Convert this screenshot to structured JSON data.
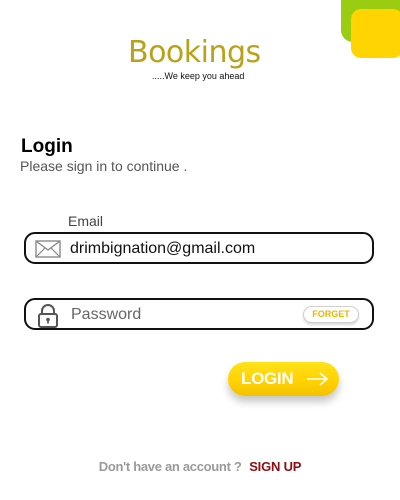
{
  "brand": {
    "title": "Bookings",
    "tagline": ".....We keep you ahead"
  },
  "login": {
    "heading": "Login",
    "subheading": "Please sign in to continue ."
  },
  "email": {
    "label": "Email",
    "value": "drimbignation@gmail.com",
    "icon": "envelope-icon"
  },
  "password": {
    "placeholder": "Password",
    "icon": "padlock-icon",
    "forget_label": "FORGET"
  },
  "submit": {
    "label": "LOGIN",
    "icon": "arrow-right-icon"
  },
  "signup": {
    "prompt": "Don't have an account ?",
    "link": "SIGN UP"
  },
  "colors": {
    "brand_gold": "#b8a21a",
    "accent_yellow": "#ffd400",
    "accent_green": "#9acd11",
    "signup_red": "#8b0f12"
  }
}
